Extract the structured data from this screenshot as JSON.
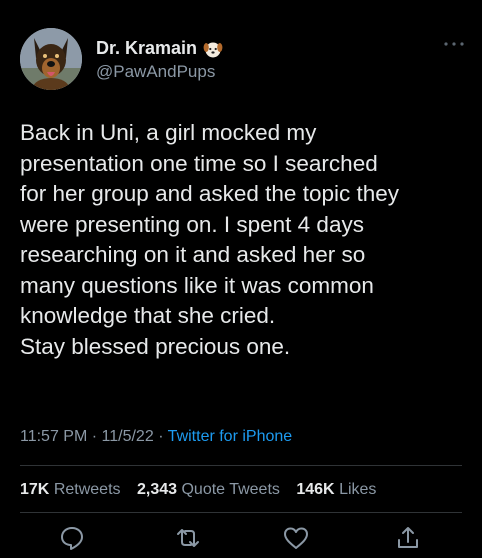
{
  "tweet": {
    "author": {
      "display_name": "Dr. Kramain",
      "name_emoji": "dog-face-emoji",
      "handle": "@PawAndPups",
      "avatar": "german-shepherd-avatar"
    },
    "text_lines": [
      "Back in Uni, a girl mocked my",
      "presentation one time so I searched",
      "for her group and asked the topic they",
      "were presenting on. I spent 4 days",
      "researching on it and asked her so",
      "many questions like it was common",
      "knowledge that she cried.",
      "Stay blessed precious one."
    ],
    "meta": {
      "time": "11:57 PM",
      "separator": "·",
      "date": "11/5/22",
      "source": "Twitter for iPhone"
    },
    "stats": {
      "retweets_count": "17K",
      "retweets_label": "Retweets",
      "quotes_count": "2,343",
      "quotes_label": "Quote Tweets",
      "likes_count": "146K",
      "likes_label": "Likes"
    },
    "actions": [
      "reply-icon",
      "retweet-icon",
      "like-icon",
      "share-icon"
    ]
  },
  "colors": {
    "background": "#000000",
    "text_primary": "#e7e9ea",
    "text_secondary": "#8b98a5",
    "link": "#1d9bf0",
    "divider": "#2f3336"
  }
}
